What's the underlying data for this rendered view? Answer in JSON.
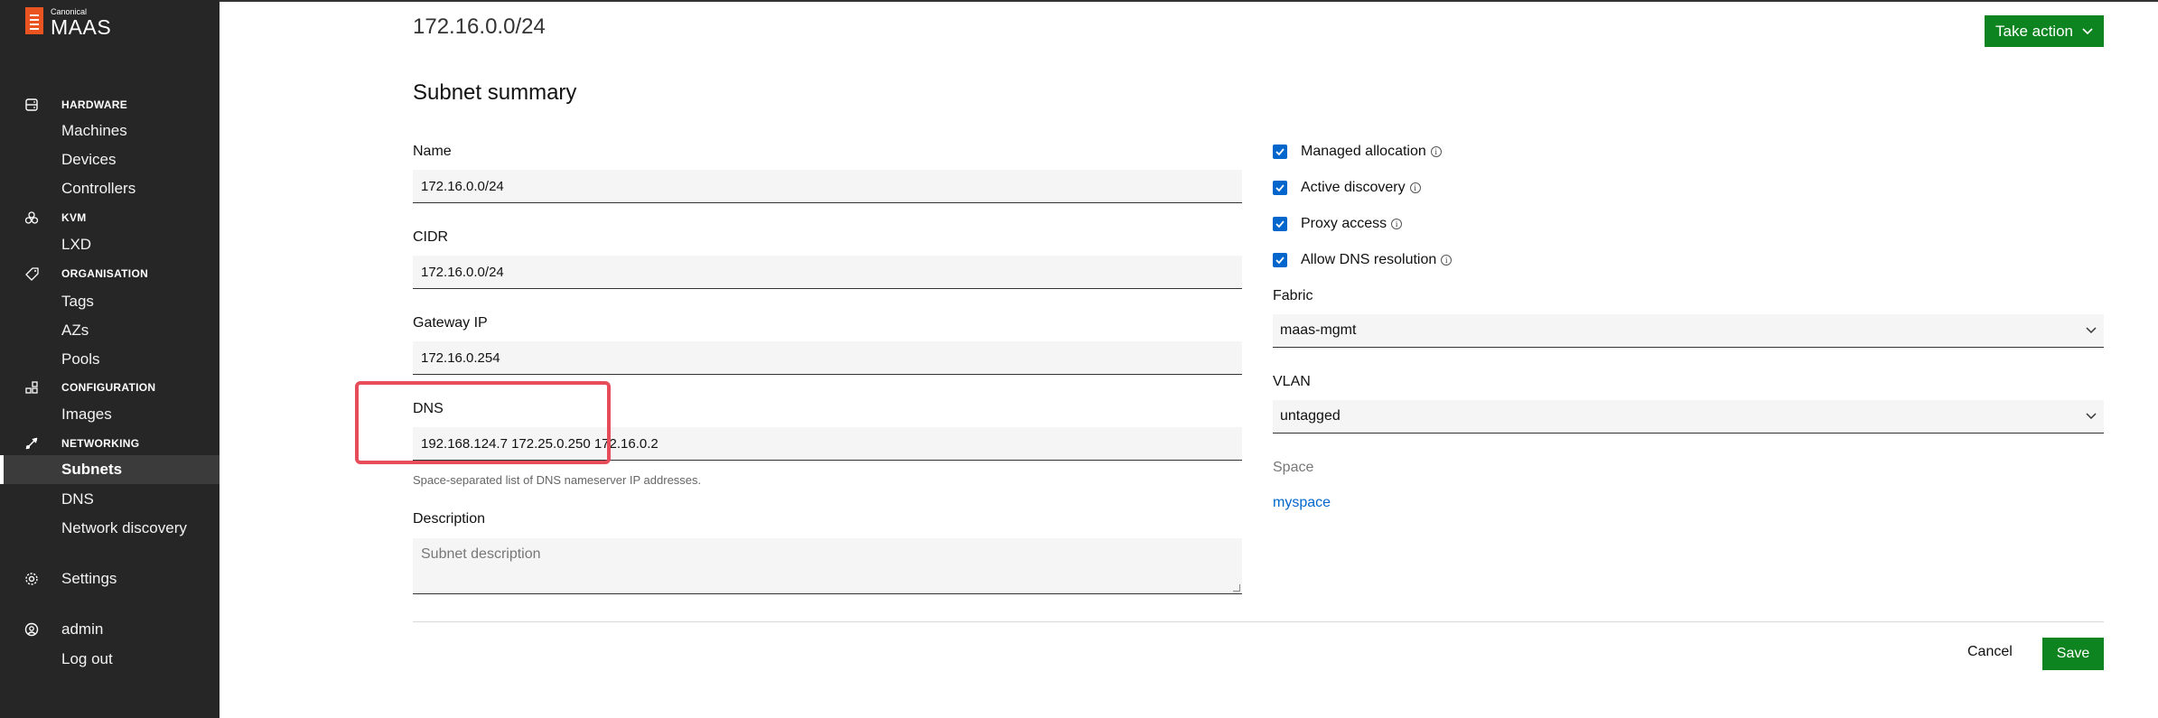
{
  "app": {
    "brand_small": "Canonical",
    "brand_big": "MAAS"
  },
  "sidebar": {
    "sections": [
      {
        "key": "hardware",
        "label": "HARDWARE",
        "icon": "server-icon",
        "items": [
          "Machines",
          "Devices",
          "Controllers"
        ]
      },
      {
        "key": "kvm",
        "label": "KVM",
        "icon": "cluster-icon",
        "items": [
          "LXD"
        ]
      },
      {
        "key": "organisation",
        "label": "ORGANISATION",
        "icon": "tag-icon",
        "items": [
          "Tags",
          "AZs",
          "Pools"
        ]
      },
      {
        "key": "configuration",
        "label": "CONFIGURATION",
        "icon": "grid-icon",
        "items": [
          "Images"
        ]
      },
      {
        "key": "networking",
        "label": "NETWORKING",
        "icon": "network-icon",
        "items": [
          "Subnets",
          "DNS",
          "Network discovery"
        ]
      }
    ],
    "active_item": "Subnets",
    "settings": "Settings",
    "user": "admin",
    "logout": "Log out"
  },
  "header": {
    "subnet": "172.16.0.0/24",
    "take_action": "Take action"
  },
  "form": {
    "section_title": "Subnet summary",
    "name": {
      "label": "Name",
      "value": "172.16.0.0/24"
    },
    "cidr": {
      "label": "CIDR",
      "value": "172.16.0.0/24"
    },
    "gateway": {
      "label": "Gateway IP",
      "value": "172.16.0.254"
    },
    "dns": {
      "label": "DNS",
      "value": "192.168.124.7 172.25.0.250 172.16.0.2",
      "help": "Space-separated list of DNS nameserver IP addresses."
    },
    "description": {
      "label": "Description",
      "placeholder": "Subnet description"
    },
    "checkboxes": [
      {
        "label": "Managed allocation",
        "checked": true
      },
      {
        "label": "Active discovery",
        "checked": true
      },
      {
        "label": "Proxy access",
        "checked": true
      },
      {
        "label": "Allow DNS resolution",
        "checked": true
      }
    ],
    "fabric": {
      "label": "Fabric",
      "value": "maas-mgmt"
    },
    "vlan": {
      "label": "VLAN",
      "value": "untagged"
    },
    "space": {
      "label": "Space",
      "value": "myspace"
    },
    "cancel": "Cancel",
    "save": "Save"
  },
  "colors": {
    "accent_green": "#0e8420",
    "checkbox_blue": "#0066cc",
    "highlight": "#e74c5b",
    "sidebar_bg": "#262626",
    "logo_orange": "#e95420"
  }
}
